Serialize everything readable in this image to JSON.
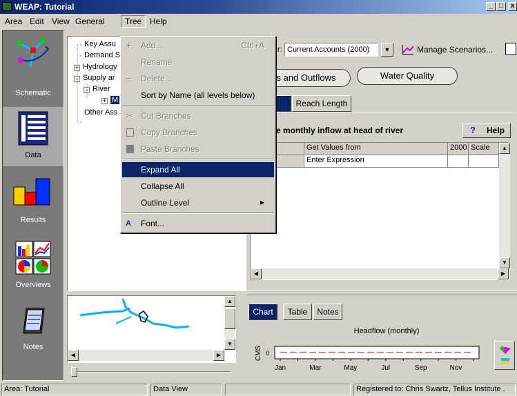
{
  "window": {
    "title": "WEAP: Tutorial",
    "min_glyph": "_",
    "max_glyph": "□",
    "close_glyph": "x"
  },
  "menubar": {
    "items": [
      "Area",
      "Edit",
      "View",
      "General",
      "Tree",
      "Help"
    ]
  },
  "sidebar": {
    "items": [
      {
        "label": "Schematic"
      },
      {
        "label": "Data"
      },
      {
        "label": "Results"
      },
      {
        "label": "Overviews"
      },
      {
        "label": "Notes"
      }
    ]
  },
  "tree": {
    "nodes": [
      {
        "label": "Key Assu"
      },
      {
        "label": "Demand S"
      },
      {
        "label": "Hydrology"
      },
      {
        "label": "Supply ar"
      },
      {
        "label": "River"
      },
      {
        "label": "M"
      },
      {
        "label": "Other Ass"
      }
    ],
    "expand_glyph": "+",
    "collapse_glyph": "-"
  },
  "tree_menu": {
    "items": [
      {
        "label": "Add...",
        "shortcut": "Ctrl+A",
        "enabled": false
      },
      {
        "label": "Rename",
        "enabled": false
      },
      {
        "label": "Delete...",
        "enabled": false
      },
      {
        "label": "Sort by Name (all levels below)",
        "enabled": true
      },
      {
        "label": "Cut Branches",
        "enabled": false
      },
      {
        "label": "Copy Branches",
        "enabled": false
      },
      {
        "label": "Paste Branches",
        "enabled": false
      },
      {
        "label": "Expand All",
        "enabled": true,
        "highlighted": true
      },
      {
        "label": "Collapse All",
        "enabled": true
      },
      {
        "label": "Outline Level",
        "enabled": true,
        "submenu_arrow": "▶"
      },
      {
        "label": "Font...",
        "enabled": true
      }
    ]
  },
  "scenario": {
    "label_fragment": "r:",
    "value": "Current Accounts (2000)",
    "manage_label": "Manage Scenarios...",
    "dropdown_glyph": "▼"
  },
  "category_buttons": {
    "inflows": "s and Outflows",
    "water_quality": "Water Quality"
  },
  "data_tabs": {
    "headflow": "ow",
    "reach_length": "Reach Length"
  },
  "variable": {
    "description": "age monthly inflow at head of river",
    "help_label": "Help",
    "help_glyph": "?"
  },
  "grid": {
    "headers": [
      "",
      "Get Values from",
      "2000",
      "Scale"
    ],
    "rows": [
      [
        "iver",
        "Enter Expression",
        "",
        ""
      ]
    ]
  },
  "result_tabs": {
    "chart": "Chart",
    "table": "Table",
    "notes": "Notes"
  },
  "chart_data": {
    "type": "line",
    "title": "Headflow (monthly)",
    "ylabel": "CMS",
    "yticks": [
      "0"
    ],
    "categories": [
      "Jan",
      "Feb",
      "Mar",
      "Apr",
      "May",
      "Jun",
      "Jul",
      "Aug",
      "Sep",
      "Oct",
      "Nov",
      "Dec"
    ],
    "tick_labels": [
      "Jan",
      "Mar",
      "May",
      "Jul",
      "Sep",
      "Nov"
    ],
    "values": [
      0,
      0,
      0,
      0,
      0,
      0,
      0,
      0,
      0,
      0,
      0,
      0
    ],
    "line_color": "#cc0000",
    "line_style": "dashed"
  },
  "status": {
    "area": "Area: Tutorial",
    "view": "Data View",
    "registration": "Registered to: Chris Swartz, Tellus Institute ."
  },
  "colors": {
    "accent": "#0a246a",
    "sidebar": "#7a7a7a",
    "river": "#00b0f0",
    "face": "#d4d0c8"
  }
}
